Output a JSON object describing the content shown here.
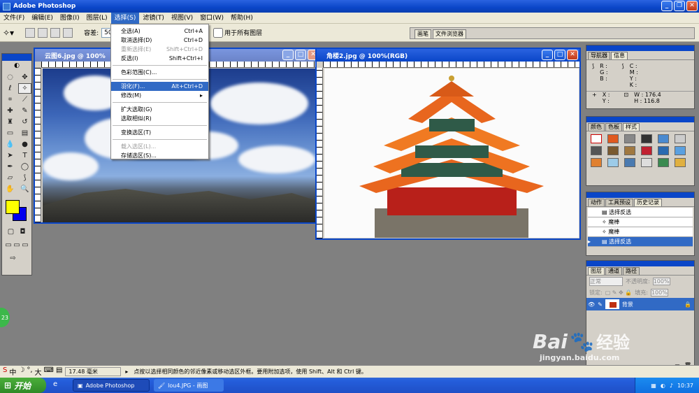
{
  "app": {
    "title": "Adobe Photoshop"
  },
  "menu": [
    "文件(F)",
    "编辑(E)",
    "图像(I)",
    "图层(L)",
    "选择(S)",
    "滤镜(T)",
    "视图(V)",
    "窗口(W)",
    "帮助(H)"
  ],
  "options": {
    "tolerance_label": "容差:",
    "tolerance_value": "50",
    "all_layers_label": "用于所有图层"
  },
  "palette_well": [
    "画笔",
    "文件浏览器"
  ],
  "select_menu": [
    {
      "label": "全选(A)",
      "shortcut": "Ctrl+A"
    },
    {
      "label": "取消选择(D)",
      "shortcut": "Ctrl+D"
    },
    {
      "label": "重新选择(E)",
      "shortcut": "Shift+Ctrl+D"
    },
    {
      "label": "反选(I)",
      "shortcut": "Shift+Ctrl+I"
    },
    {
      "label": "色彩范围(C)...",
      "shortcut": ""
    },
    {
      "label": "羽化(F)...",
      "shortcut": "Alt+Ctrl+D"
    },
    {
      "label": "修改(M)",
      "shortcut": "▸"
    },
    {
      "label": "扩大选取(G)",
      "shortcut": ""
    },
    {
      "label": "选取相似(R)",
      "shortcut": ""
    },
    {
      "label": "变换选区(T)",
      "shortcut": ""
    },
    {
      "label": "载入选区(L)...",
      "shortcut": ""
    },
    {
      "label": "存储选区(S)...",
      "shortcut": ""
    }
  ],
  "doc1": {
    "title": "云图6.jpg @ 100%"
  },
  "doc2": {
    "title": "角楼2.jpg @ 100%(RGB)"
  },
  "navigator": {
    "tabs": [
      "导航器",
      "信息"
    ],
    "R": "R :",
    "G": "G :",
    "B": "B :",
    "C": "C :",
    "M": "M :",
    "Y": "Y :",
    "K": "K :",
    "X": "X :",
    "Y2": "Y :",
    "W": "W :",
    "H": "H :",
    "w_val": "176.4",
    "h_val": "116.8"
  },
  "swatches_panel": {
    "tabs": [
      "颜色",
      "色板",
      "样式"
    ]
  },
  "history": {
    "tabs": [
      "动作",
      "工具预设",
      "历史记录"
    ],
    "items": [
      "选择反选",
      "魔棒",
      "魔棒",
      "选择反选"
    ]
  },
  "layers": {
    "tabs": [
      "图层",
      "通道",
      "路径"
    ],
    "mode": "正常",
    "opacity_label": "不透明度:",
    "opacity": "100%",
    "lock_label": "锁定:",
    "fill_label": "填充:",
    "fill": "100%",
    "layer_name": "背景"
  },
  "status": {
    "size": "17.48 毫米",
    "hint": "点按以选择相同颜色的邻近像素或移动选区外框。要用附加选项，使用 Shift、Alt 和 Ctrl 键。",
    "ime": "中",
    "ime2": "大"
  },
  "taskbar": {
    "start": "开始",
    "task1": "Adobe Photoshop",
    "task2": "lou4.JPG - 画图",
    "clock": "10:37"
  },
  "watermark": {
    "brand": "Bai",
    "brand2": "经验",
    "url": "jingyan.baidu.com"
  },
  "badge": "23"
}
